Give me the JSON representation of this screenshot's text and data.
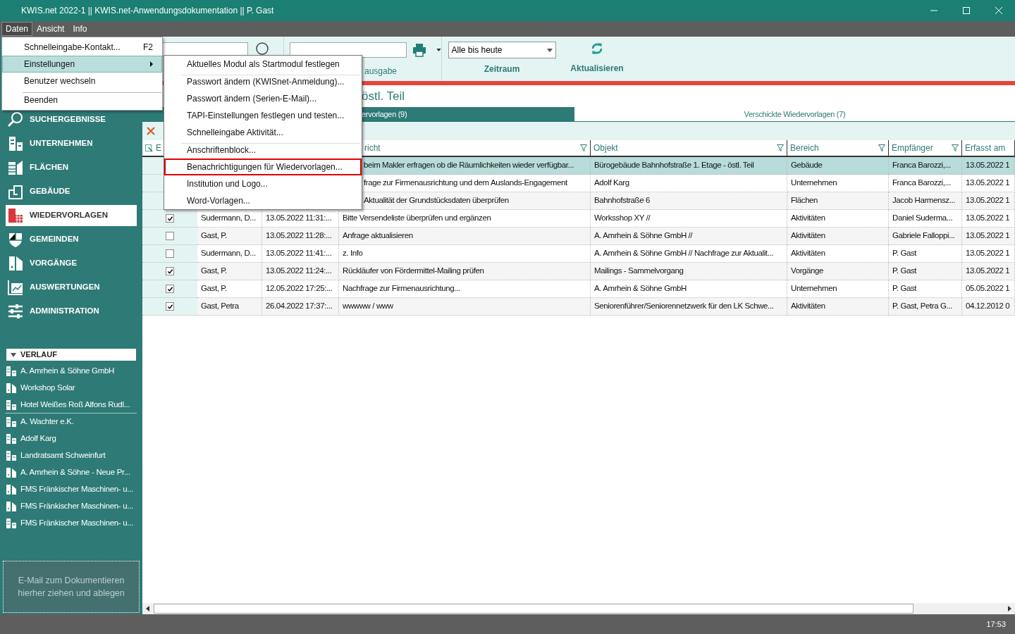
{
  "window": {
    "title": "KWIS.net 2022-1 || KWIS.net-Anwendungsdokumentation || P. Gast"
  },
  "menubar": [
    {
      "label": "Daten",
      "selected": true
    },
    {
      "label": "Ansicht",
      "selected": false
    },
    {
      "label": "Info",
      "selected": false
    }
  ],
  "menu": [
    {
      "label": "Schnelleingabe-Kontakt...",
      "shortcut": "F2",
      "selected": false,
      "submenu": false,
      "separator_before": false
    },
    {
      "label": "Einstellungen",
      "selected": true,
      "submenu": true,
      "separator_before": false
    },
    {
      "label": "Benutzer wechseln",
      "selected": false,
      "submenu": false,
      "separator_before": false
    },
    {
      "label": "Beenden",
      "selected": false,
      "submenu": false,
      "separator_before": true
    }
  ],
  "submenu": [
    {
      "label": "Aktuelles Modul als Startmodul festlegen",
      "outlined": false,
      "separator_before": false
    },
    {
      "label": "Passwort ändern (KWISnet-Anmeldung)...",
      "outlined": false,
      "separator_before": true
    },
    {
      "label": "Passwort ändern (Serien-E-Mail)...",
      "outlined": false,
      "separator_before": false
    },
    {
      "label": "TAPI-Einstellungen festlegen und testen...",
      "outlined": false,
      "separator_before": false
    },
    {
      "label": "Schnelleingabe Aktivität...",
      "outlined": false,
      "separator_before": false
    },
    {
      "label": "Anschriftenblock...",
      "outlined": false,
      "separator_before": true
    },
    {
      "label": "Benachrichtigungen für Wiedervorlagen...",
      "outlined": true,
      "separator_before": false
    },
    {
      "label": "Institution und Logo...",
      "outlined": false,
      "separator_before": false
    },
    {
      "label": "Word-Vorlagen...",
      "outlined": false,
      "separator_before": false
    }
  ],
  "toolbar": {
    "output_label": "ausgabe",
    "period": {
      "value": "Alle bis heute",
      "label": "Zeitraum"
    },
    "refresh_label": "Aktualisieren"
  },
  "sidebar": {
    "items": [
      {
        "label": "SUCHERGEBNISSE",
        "selected": false
      },
      {
        "label": "UNTERNEHMEN",
        "selected": false
      },
      {
        "label": "FLÄCHEN",
        "selected": false
      },
      {
        "label": "GEBÄUDE",
        "selected": false
      },
      {
        "label": "WIEDERVORLAGEN",
        "selected": true
      },
      {
        "label": "GEMEINDEN",
        "selected": false
      },
      {
        "label": "VORGÄNGE",
        "selected": false
      },
      {
        "label": "AUSWERTUNGEN",
        "selected": false
      },
      {
        "label": "ADMINISTRATION",
        "selected": false
      }
    ],
    "history": {
      "title": "VERLAUF",
      "items": [
        {
          "label": "A. Amrhein & Söhne GmbH",
          "kind": "company",
          "separator_after": false
        },
        {
          "label": "Workshop Solar",
          "kind": "process",
          "separator_after": false
        },
        {
          "label": "Hotel Weißes Roß Alfons Rudl...",
          "kind": "company",
          "separator_after": true
        },
        {
          "label": "A. Wachter e.K.",
          "kind": "company",
          "separator_after": false
        },
        {
          "label": "Adolf Karg",
          "kind": "company",
          "separator_after": false
        },
        {
          "label": "Landratsamt Schweinfurt",
          "kind": "company",
          "separator_after": false
        },
        {
          "label": "A. Amrhein & Söhne - Neue Pr...",
          "kind": "process",
          "separator_after": false
        },
        {
          "label": "FMS Fränkischer Maschinen- u...",
          "kind": "process",
          "separator_after": false
        },
        {
          "label": "FMS Fränkischer Maschinen- u...",
          "kind": "process",
          "separator_after": false
        },
        {
          "label": "FMS Fränkischer Maschinen- u...",
          "kind": "company",
          "separator_after": false
        }
      ]
    },
    "dropzone": "E-Mail zum Dokumentieren hierher ziehen und ablegen"
  },
  "page_title": "östl. Teil",
  "tabs": [
    {
      "label": "ervorlagen (9)",
      "selected": true
    },
    {
      "label": "Verschickte Wiedervorlagen (7)",
      "selected": false
    }
  ],
  "table": {
    "columns": [
      {
        "label": "E"
      },
      {
        "label": "richt",
        "filter": true
      },
      {
        "label": "Objekt",
        "filter": true
      },
      {
        "label": "Bereich",
        "filter": true
      },
      {
        "label": "Empfänger",
        "filter": true
      },
      {
        "label": "Erfasst am",
        "filter": false
      }
    ],
    "rows": [
      {
        "selected": true,
        "message": "beim Makler erfragen ob die Räumlichkeiten wieder verfügbar...",
        "object": "Bürogebäude Bahnhofstraße 1. Etage - östl. Teil",
        "area": "Gebäude",
        "recipient": "Franca Barozzi,...",
        "created": "13.05.2022 1"
      },
      {
        "selected": false,
        "message": "frage zur Firmenausrichtung und dem Auslands-Engagement",
        "object": "Adolf Karg",
        "area": "Unternehmen",
        "recipient": "Franca Barozzi,...",
        "created": "13.05.2022 1"
      },
      {
        "selected": false,
        "message": "Aktualität der Grundstücksdaten überprüfen",
        "object": "Bahnhofstraße 6",
        "area": "Flächen",
        "recipient": "Jacob Harmensz...",
        "created": "13.05.2022 1"
      },
      {
        "selected": false,
        "checked": true,
        "author": "Sudermann, D...",
        "date": "13.05.2022 11:31:...",
        "message": "Bitte Versendeliste überprüfen und ergänzen",
        "object": "Worksshop XY //",
        "area": "Aktivitäten",
        "recipient": "Daniel Suderma...",
        "created": "13.05.2022 1"
      },
      {
        "selected": false,
        "checked": false,
        "author": "Gast, P.",
        "date": "13.05.2022 11:28:...",
        "message": "Anfrage aktualisieren",
        "object": "A. Amrhein & Söhne GmbH //",
        "area": "Aktivitäten",
        "recipient": "Gabriele Falloppi...",
        "created": "13.05.2022 1"
      },
      {
        "selected": false,
        "checked": false,
        "author": "Sudermann, D...",
        "date": "13.05.2022 11:41:...",
        "message": "z. Info",
        "object": "A. Amrhein & Söhne GmbH // Nachfrage zur Aktualit...",
        "area": "Aktivitäten",
        "recipient": "P. Gast",
        "created": "13.05.2022 1"
      },
      {
        "selected": false,
        "checked": true,
        "author": "Gast, P.",
        "date": "13.05.2022 11:24:...",
        "message": "Rückläufer von Fördermittel-Mailing prüfen",
        "object": "Mailings - Sammelvorgang",
        "area": "Vorgänge",
        "recipient": "P. Gast",
        "created": "13.05.2022 1"
      },
      {
        "selected": false,
        "checked": true,
        "author": "Gast, P.",
        "date": "12.05.2022 17:25:...",
        "message": "Nachfrage zur Firmenausrichtung...",
        "object": "A. Amrhein & Söhne GmbH",
        "area": "Unternehmen",
        "recipient": "P. Gast",
        "created": "05.05.2022 1"
      },
      {
        "selected": false,
        "checked": true,
        "author": "Gast, Petra",
        "date": "26.04.2022 17:37:...",
        "message": "wwwww / www",
        "object": "Seniorenführer/Seniorennetzwerk für den LK Schwe...",
        "area": "Aktivitäten",
        "recipient": "P. Gast, Petra G...",
        "created": "04.12.2012 0"
      }
    ]
  },
  "status_bar": {
    "time": "17:53"
  }
}
